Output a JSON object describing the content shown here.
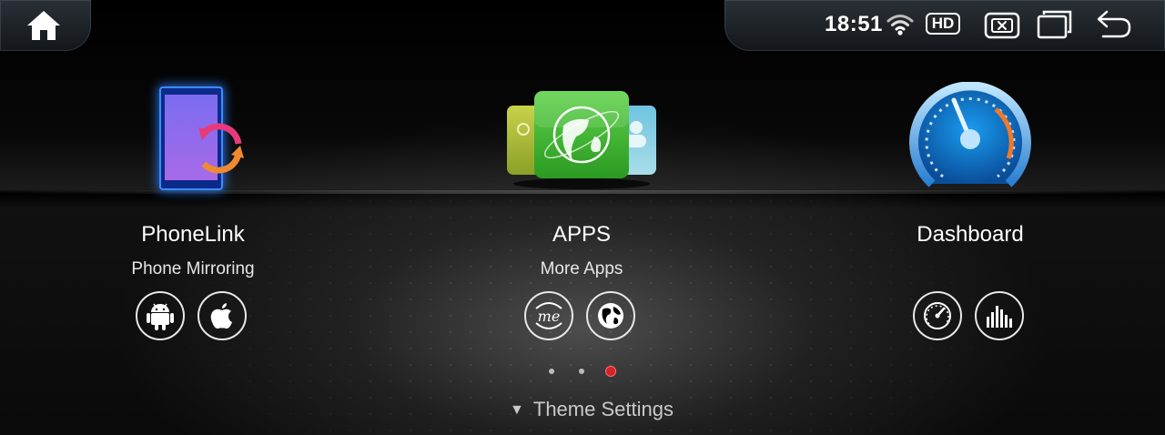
{
  "status_bar": {
    "time": "18:51",
    "hd_label": "HD",
    "icons": [
      "home-icon",
      "wifi-icon",
      "hd-icon",
      "close-window-icon",
      "recent-apps-icon",
      "back-icon"
    ]
  },
  "apps": [
    {
      "title": "PhoneLink",
      "subtitle": "Phone Mirroring",
      "icon": "phonelink-icon",
      "shortcuts": [
        "android-icon",
        "apple-icon"
      ]
    },
    {
      "title": "APPS",
      "subtitle": "More Apps",
      "icon": "apps-icon",
      "shortcuts": [
        "me-icon",
        "globe-icon"
      ]
    },
    {
      "title": "Dashboard",
      "subtitle": "",
      "icon": "speedometer-icon",
      "shortcuts": [
        "gauge-icon",
        "equalizer-icon"
      ]
    }
  ],
  "pager": {
    "pages": 3,
    "active_index": 2
  },
  "footer": {
    "theme_settings": "Theme Settings"
  },
  "colors": {
    "accent_red": "#d0242a",
    "phone_glow": "#3aa0ff",
    "apps_green": "#3cb832",
    "gauge_blue": "#1d8ae0"
  }
}
